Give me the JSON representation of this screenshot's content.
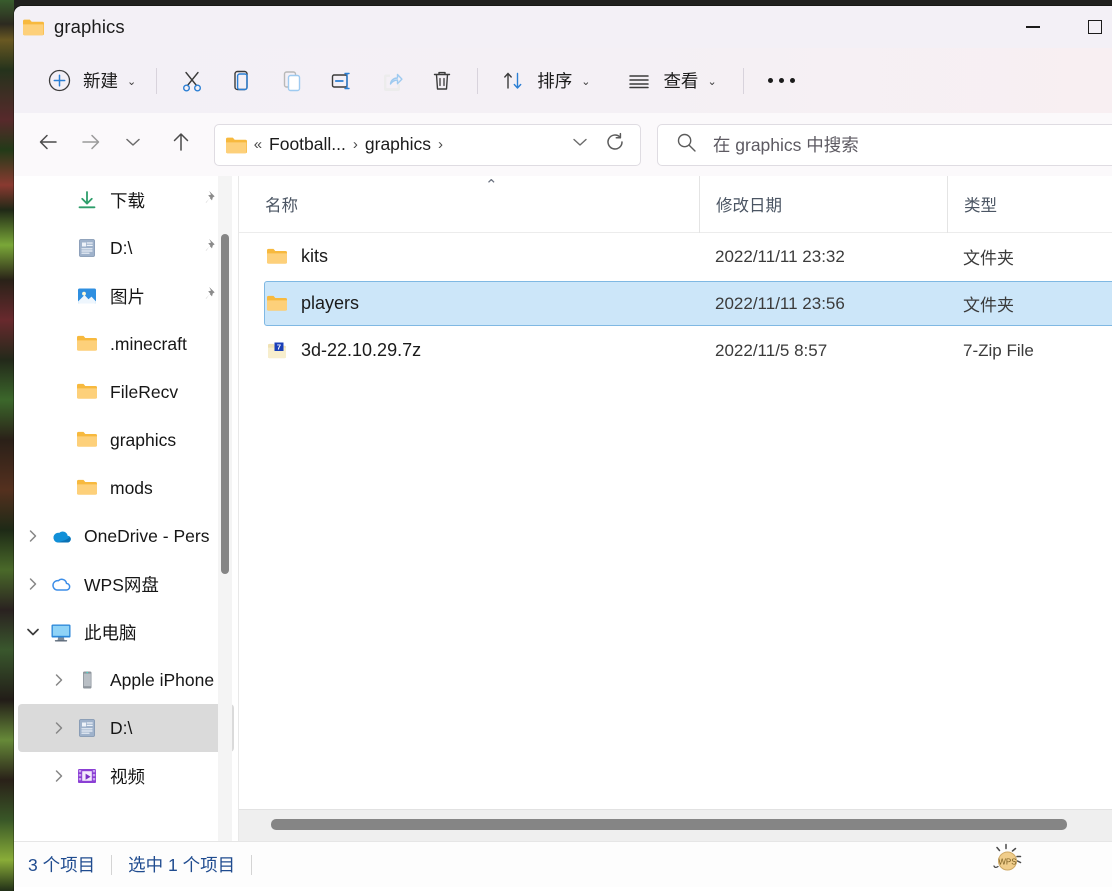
{
  "window": {
    "title": "graphics",
    "title_icon": "folder-icon",
    "controls": {
      "minimize": "minimize-icon",
      "maximize": "maximize-icon"
    }
  },
  "toolbar": {
    "new_label": "新建",
    "new_icon": "plus-circle-icon",
    "cut_icon": "scissors-icon",
    "copy_icon": "copy-icon",
    "paste_icon": "paste-icon",
    "rename_icon": "rename-icon",
    "share_icon": "share-icon",
    "delete_icon": "trash-icon",
    "sort_label": "排序",
    "sort_icon": "sort-arrows-icon",
    "view_label": "查看",
    "view_icon": "list-lines-icon",
    "more_icon": "ellipsis-icon",
    "dropdown_caret": "⌄"
  },
  "navbar": {
    "back_icon": "arrow-left-icon",
    "forward_icon": "arrow-right-icon",
    "recent_icon": "chevron-down-icon",
    "up_icon": "arrow-up-icon",
    "refresh_icon": "refresh-icon",
    "breadcrumb": {
      "folder_icon": "folder-icon",
      "overflow": "«",
      "segments": [
        "Football...",
        "graphics"
      ],
      "separator": "›",
      "dropdown_icon": "chevron-down-icon"
    },
    "search": {
      "icon": "search-icon",
      "placeholder": "在 graphics 中搜索"
    }
  },
  "sidebar": {
    "items": [
      {
        "label": "下载",
        "icon": "download-icon",
        "pinned": true,
        "indent": 1,
        "twisty": "",
        "selected": false
      },
      {
        "label": "D:\\",
        "icon": "drive-doc-icon",
        "pinned": true,
        "indent": 1,
        "twisty": "",
        "selected": false
      },
      {
        "label": "图片",
        "icon": "pictures-icon",
        "pinned": true,
        "indent": 1,
        "twisty": "",
        "selected": false
      },
      {
        "label": ".minecraft",
        "icon": "folder-icon",
        "pinned": false,
        "indent": 1,
        "twisty": "",
        "selected": false
      },
      {
        "label": "FileRecv",
        "icon": "folder-icon",
        "pinned": false,
        "indent": 1,
        "twisty": "",
        "selected": false
      },
      {
        "label": "graphics",
        "icon": "folder-icon",
        "pinned": false,
        "indent": 1,
        "twisty": "",
        "selected": false
      },
      {
        "label": "mods",
        "icon": "folder-icon",
        "pinned": false,
        "indent": 1,
        "twisty": "",
        "selected": false
      },
      {
        "label": "OneDrive - Pers",
        "icon": "onedrive-icon",
        "pinned": false,
        "indent": 0,
        "twisty": "›",
        "selected": false
      },
      {
        "label": "WPS网盘",
        "icon": "wps-cloud-icon",
        "pinned": false,
        "indent": 0,
        "twisty": "›",
        "selected": false
      },
      {
        "label": "此电脑",
        "icon": "this-pc-icon",
        "pinned": false,
        "indent": 0,
        "twisty": "⌄",
        "selected": false
      },
      {
        "label": "Apple iPhone",
        "icon": "iphone-icon",
        "pinned": false,
        "indent": 1,
        "twisty": "›",
        "selected": false
      },
      {
        "label": "D:\\",
        "icon": "drive-doc-icon",
        "pinned": false,
        "indent": 1,
        "twisty": "›",
        "selected": true
      },
      {
        "label": "视频",
        "icon": "videos-icon",
        "pinned": false,
        "indent": 1,
        "twisty": "›",
        "selected": false
      }
    ],
    "pin_icon": "pin-icon",
    "scrollbar": "vertical-scrollbar"
  },
  "filelist": {
    "columns": [
      "名称",
      "修改日期",
      "类型"
    ],
    "sort_indicator": "⌃",
    "sort_column": "名称",
    "rows": [
      {
        "name": "kits",
        "icon": "folder-icon",
        "date": "2022/11/11 23:32",
        "type": "文件夹",
        "selected": false
      },
      {
        "name": "players",
        "icon": "folder-icon",
        "date": "2022/11/11 23:56",
        "type": "文件夹",
        "selected": true
      },
      {
        "name": "3d-22.10.29.7z",
        "icon": "sevenzip-icon",
        "date": "2022/11/5 8:57",
        "type": "7-Zip File",
        "selected": false
      }
    ],
    "horizontal_scrollbar": "horizontal-scrollbar"
  },
  "statusbar": {
    "item_count": "3 个项目",
    "selection": "选中 1 个项目",
    "wps_icon": "wps-bulb-icon"
  },
  "colors": {
    "selection_fill": "#cce6f9",
    "selection_border": "#7fb8e3",
    "accent_blue": "#1f7fd4",
    "status_text": "#1f4b8f",
    "titlebar_bg": "#f3f0f6",
    "folder_yellow": "#fcc75a"
  }
}
